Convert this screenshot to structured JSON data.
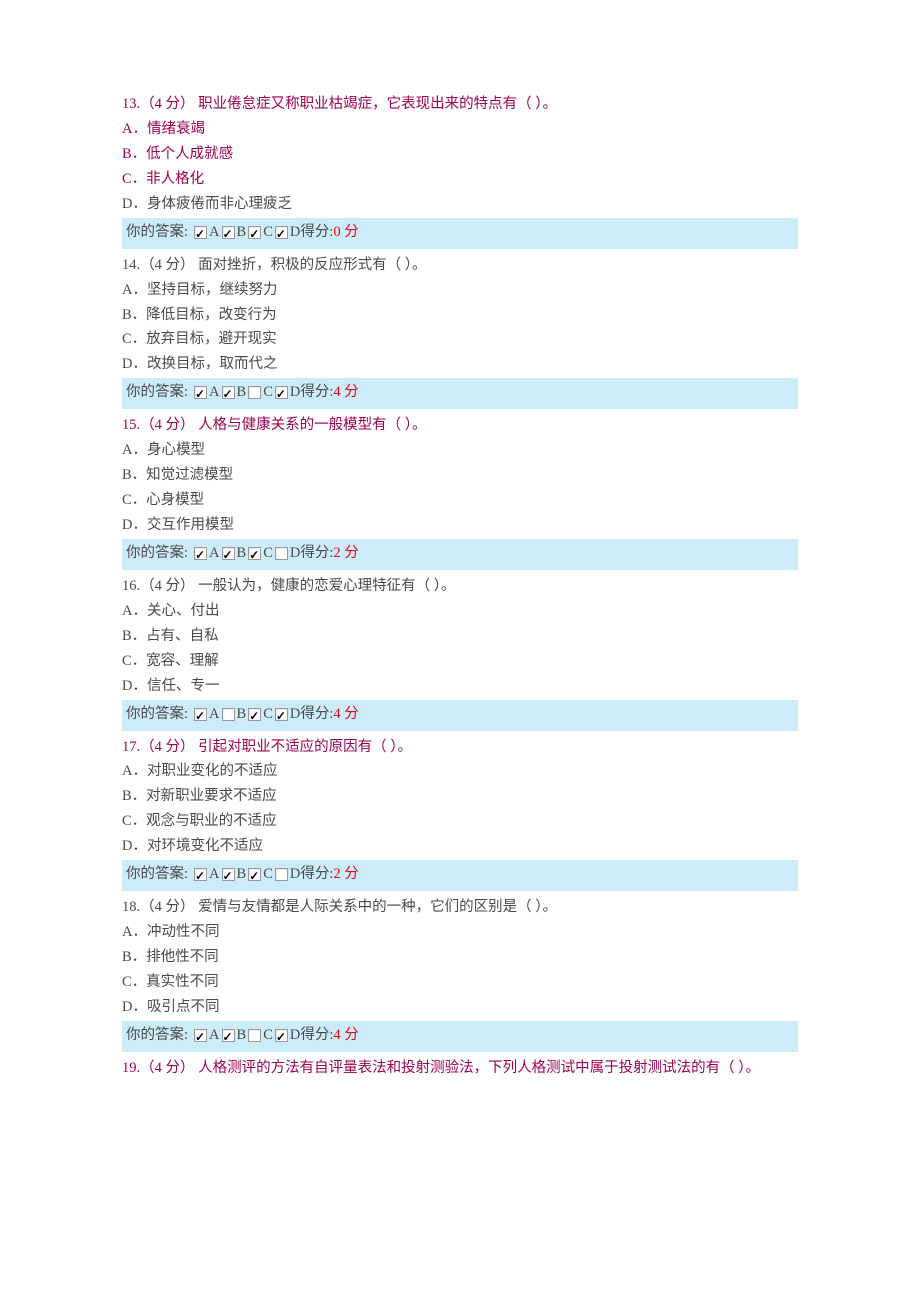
{
  "questions": [
    {
      "num": "13",
      "points_label": "4 分",
      "title_red": true,
      "stem": "职业倦怠症又称职业枯竭症，它表现出来的特点有（ ）。",
      "options": [
        {
          "label": "A．情绪衰竭",
          "red": true
        },
        {
          "label": "B．低个人成就感",
          "red": true
        },
        {
          "label": "C．非人格化",
          "red": true
        },
        {
          "label": "D．身体疲倦而非心理疲乏",
          "red": false
        }
      ],
      "answer_label": "你的答案:",
      "checks": [
        {
          "letter": "A",
          "checked": true
        },
        {
          "letter": "B",
          "checked": true
        },
        {
          "letter": "C",
          "checked": true
        },
        {
          "letter": "D",
          "checked": true
        }
      ],
      "score_label": "得分:",
      "score_value": "0 分"
    },
    {
      "num": "14",
      "points_label": "4 分",
      "title_red": false,
      "stem": "面对挫折，积极的反应形式有（ ）。",
      "options": [
        {
          "label": "A．坚持目标，继续努力",
          "red": false
        },
        {
          "label": "B．降低目标，改变行为",
          "red": false
        },
        {
          "label": "C．放弃目标，避开现实",
          "red": false
        },
        {
          "label": "D．改换目标，取而代之",
          "red": false
        }
      ],
      "answer_label": "你的答案:",
      "checks": [
        {
          "letter": "A",
          "checked": true
        },
        {
          "letter": "B",
          "checked": true
        },
        {
          "letter": "C",
          "checked": false
        },
        {
          "letter": "D",
          "checked": true
        }
      ],
      "score_label": "得分:",
      "score_value": "4 分"
    },
    {
      "num": "15",
      "points_label": "4 分",
      "title_red": true,
      "stem": "人格与健康关系的一般模型有（ ）。",
      "options": [
        {
          "label": "A．身心模型",
          "red": false
        },
        {
          "label": "B．知觉过滤模型",
          "red": false
        },
        {
          "label": "C．心身模型",
          "red": false
        },
        {
          "label": "D．交互作用模型",
          "red": false
        }
      ],
      "answer_label": "你的答案:",
      "checks": [
        {
          "letter": "A",
          "checked": true
        },
        {
          "letter": "B",
          "checked": true
        },
        {
          "letter": "C",
          "checked": true
        },
        {
          "letter": "D",
          "checked": false
        }
      ],
      "score_label": "得分:",
      "score_value": "2 分"
    },
    {
      "num": "16",
      "points_label": "4 分",
      "title_red": false,
      "stem": "一般认为，健康的恋爱心理特征有（ ）。",
      "options": [
        {
          "label": "A．关心、付出",
          "red": false
        },
        {
          "label": "B．占有、自私",
          "red": false
        },
        {
          "label": "C．宽容、理解",
          "red": false
        },
        {
          "label": "D．信任、专一",
          "red": false
        }
      ],
      "answer_label": "你的答案:",
      "checks": [
        {
          "letter": "A",
          "checked": true
        },
        {
          "letter": "B",
          "checked": false
        },
        {
          "letter": "C",
          "checked": true
        },
        {
          "letter": "D",
          "checked": true
        }
      ],
      "score_label": "得分:",
      "score_value": "4 分"
    },
    {
      "num": "17",
      "points_label": "4 分",
      "title_red": true,
      "stem": "引起对职业不适应的原因有（ ）。",
      "options": [
        {
          "label": "A．对职业变化的不适应",
          "red": false
        },
        {
          "label": "B．对新职业要求不适应",
          "red": false
        },
        {
          "label": "C．观念与职业的不适应",
          "red": false
        },
        {
          "label": "D．对环境变化不适应",
          "red": false
        }
      ],
      "answer_label": "你的答案:",
      "checks": [
        {
          "letter": "A",
          "checked": true
        },
        {
          "letter": "B",
          "checked": true
        },
        {
          "letter": "C",
          "checked": true
        },
        {
          "letter": "D",
          "checked": false
        }
      ],
      "score_label": "得分:",
      "score_value": "2 分"
    },
    {
      "num": "18",
      "points_label": "4 分",
      "title_red": false,
      "stem": "爱情与友情都是人际关系中的一种，它们的区别是（ ）。",
      "options": [
        {
          "label": "A．冲动性不同",
          "red": false
        },
        {
          "label": "B．排他性不同",
          "red": false
        },
        {
          "label": "C．真实性不同",
          "red": false
        },
        {
          "label": "D．吸引点不同",
          "red": false
        }
      ],
      "answer_label": "你的答案:",
      "checks": [
        {
          "letter": "A",
          "checked": true
        },
        {
          "letter": "B",
          "checked": true
        },
        {
          "letter": "C",
          "checked": false
        },
        {
          "letter": "D",
          "checked": true
        }
      ],
      "score_label": "得分:",
      "score_value": "4 分"
    },
    {
      "num": "19",
      "points_label": "4 分",
      "title_red": true,
      "stem": "人格测评的方法有自评量表法和投射测验法，下列人格测试中属于投射测试法的有（ ）。",
      "options": [],
      "answer_label": "",
      "checks": [],
      "score_label": "",
      "score_value": ""
    }
  ]
}
